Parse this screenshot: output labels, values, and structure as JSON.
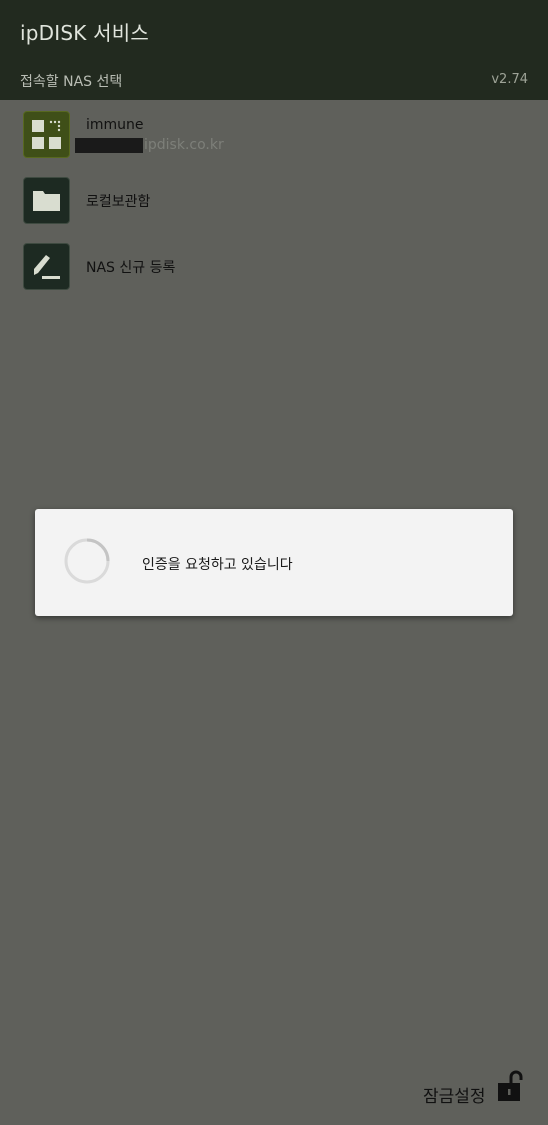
{
  "header": {
    "title": "ipDISK 서비스",
    "subtitle": "접속할 NAS 선택",
    "version": "v2.74"
  },
  "nas_list": [
    {
      "icon": "grid-apps-icon",
      "label": "immune",
      "sublabel": "ipdisk.co.kr"
    },
    {
      "icon": "folder-icon",
      "label": "로컬보관함"
    },
    {
      "icon": "pencil-icon",
      "label": "NAS 신규 등록"
    }
  ],
  "dialog": {
    "message": "인증을 요청하고 있습니다"
  },
  "footer": {
    "lock_label": "잠금설정",
    "lock_icon": "unlock-icon"
  },
  "colors": {
    "appbar": "#222a1f",
    "background": "#5f605b",
    "dialog": "#f3f3f3",
    "icon_dark": "#1d2a22",
    "icon_olive": "#3f4f18"
  }
}
